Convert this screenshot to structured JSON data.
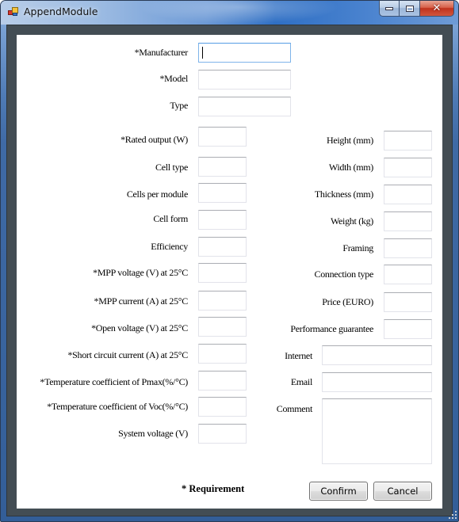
{
  "window": {
    "title": "AppendModule",
    "icons": {
      "app": "app-icon",
      "minimize": "minimize-icon",
      "maximize": "maximize-icon",
      "close": "close-icon"
    },
    "close_glyph": "✕"
  },
  "form": {
    "left_fields": [
      {
        "key": "manufacturer",
        "label": "*Manufacturer",
        "value": "",
        "focused": true
      },
      {
        "key": "model",
        "label": "*Model",
        "value": ""
      },
      {
        "key": "type",
        "label": "Type",
        "value": ""
      },
      {
        "key": "rated_output",
        "label": "*Rated output (W)",
        "value": ""
      },
      {
        "key": "cell_type",
        "label": "Cell type",
        "value": ""
      },
      {
        "key": "cells_per_module",
        "label": "Cells per module",
        "value": ""
      },
      {
        "key": "cell_form",
        "label": "Cell form",
        "value": ""
      },
      {
        "key": "efficiency",
        "label": "Efficiency",
        "value": ""
      },
      {
        "key": "mpp_voltage",
        "label": "*MPP voltage (V) at 25°C",
        "value": ""
      },
      {
        "key": "mpp_current",
        "label": "*MPP current (A) at 25°C",
        "value": ""
      },
      {
        "key": "open_voltage",
        "label": "*Open voltage (V) at 25°C",
        "value": ""
      },
      {
        "key": "short_circuit_current",
        "label": "*Short circuit current (A) at 25°C",
        "value": ""
      },
      {
        "key": "temp_coeff_pmax",
        "label": "*Temperature coefficient of Pmax(%/°C)",
        "value": ""
      },
      {
        "key": "temp_coeff_voc",
        "label": "*Temperature coefficient of Voc(%/°C)",
        "value": ""
      },
      {
        "key": "system_voltage",
        "label": "System voltage (V)",
        "value": ""
      }
    ],
    "right_fields": [
      {
        "key": "height",
        "label": "Height (mm)",
        "value": ""
      },
      {
        "key": "width",
        "label": "Width (mm)",
        "value": ""
      },
      {
        "key": "thickness",
        "label": "Thickness (mm)",
        "value": ""
      },
      {
        "key": "weight",
        "label": "Weight (kg)",
        "value": ""
      },
      {
        "key": "framing",
        "label": "Framing",
        "value": ""
      },
      {
        "key": "connection_type",
        "label": "Connection type",
        "value": ""
      },
      {
        "key": "price",
        "label": "Price (EURO)",
        "value": ""
      },
      {
        "key": "performance_guarantee",
        "label": "Performance guarantee",
        "value": ""
      },
      {
        "key": "internet",
        "label": "Internet",
        "value": ""
      },
      {
        "key": "email",
        "label": "Email",
        "value": ""
      },
      {
        "key": "comment",
        "label": "Comment",
        "value": ""
      }
    ],
    "requirement_note": "* Requirement",
    "buttons": {
      "confirm": "Confirm",
      "cancel": "Cancel"
    }
  }
}
